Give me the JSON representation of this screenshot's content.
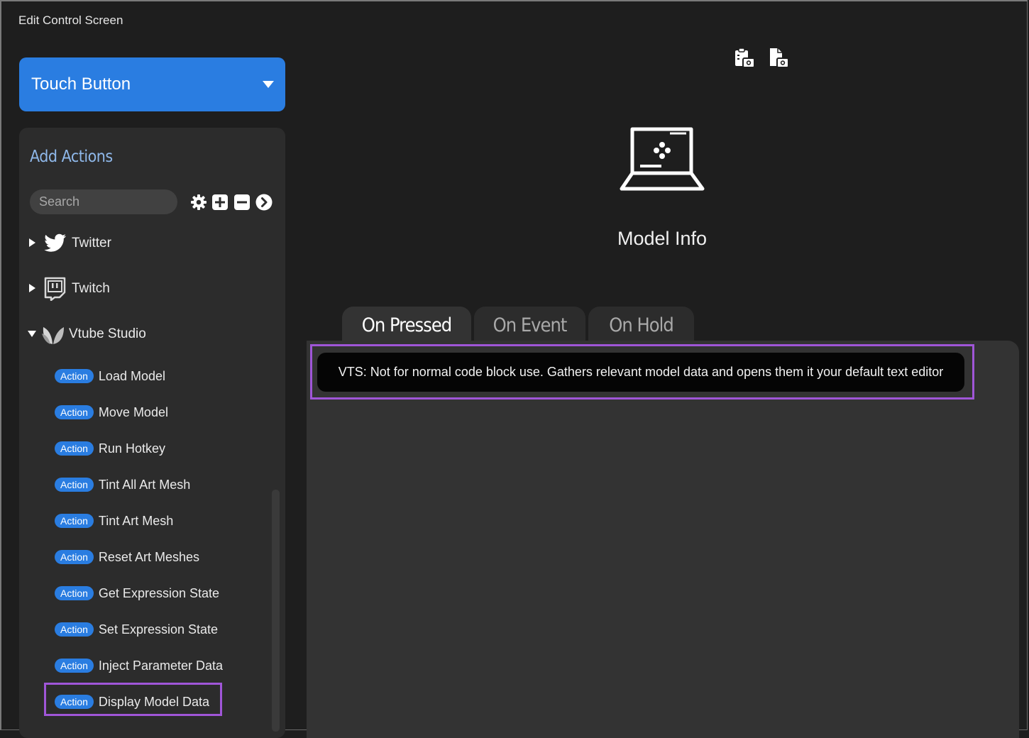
{
  "window": {
    "title": "Edit Control Screen"
  },
  "control_type": {
    "selected": "Touch Button"
  },
  "sidebar": {
    "title": "Add Actions",
    "search_placeholder": "Search",
    "tools": [
      "gear-icon",
      "plus-icon",
      "minus-icon",
      "arrow-right-circle-icon"
    ],
    "groups": [
      {
        "label": "Twitter",
        "icon": "twitter-icon",
        "expanded": false
      },
      {
        "label": "Twitch",
        "icon": "twitch-icon",
        "expanded": false
      },
      {
        "label": "Vtube Studio",
        "icon": "vtube-studio-icon",
        "expanded": true
      }
    ],
    "badge_label": "Action",
    "actions": [
      "Load Model",
      "Move Model",
      "Run Hotkey",
      "Tint All Art Mesh",
      "Tint Art Mesh",
      "Reset Art Meshes",
      "Get Expression State",
      "Set Expression State",
      "Inject Parameter Data",
      "Display Model Data"
    ],
    "highlighted_action": "Display Model Data"
  },
  "top_toolbar": {
    "icons": [
      "clipboard-camera-icon",
      "document-camera-icon"
    ]
  },
  "control": {
    "icon": "laptop-gamepad-icon",
    "title": "Model Info"
  },
  "tabs": [
    {
      "label": "On Pressed",
      "active": true
    },
    {
      "label": "On Event",
      "active": false
    },
    {
      "label": "On Hold",
      "active": false
    }
  ],
  "description": "VTS: Not for normal code block use. Gathers relevant model data and opens them it your default text editor",
  "colors": {
    "accent": "#2a7de1",
    "highlight": "#a056d8",
    "background": "#1e1e1e"
  }
}
